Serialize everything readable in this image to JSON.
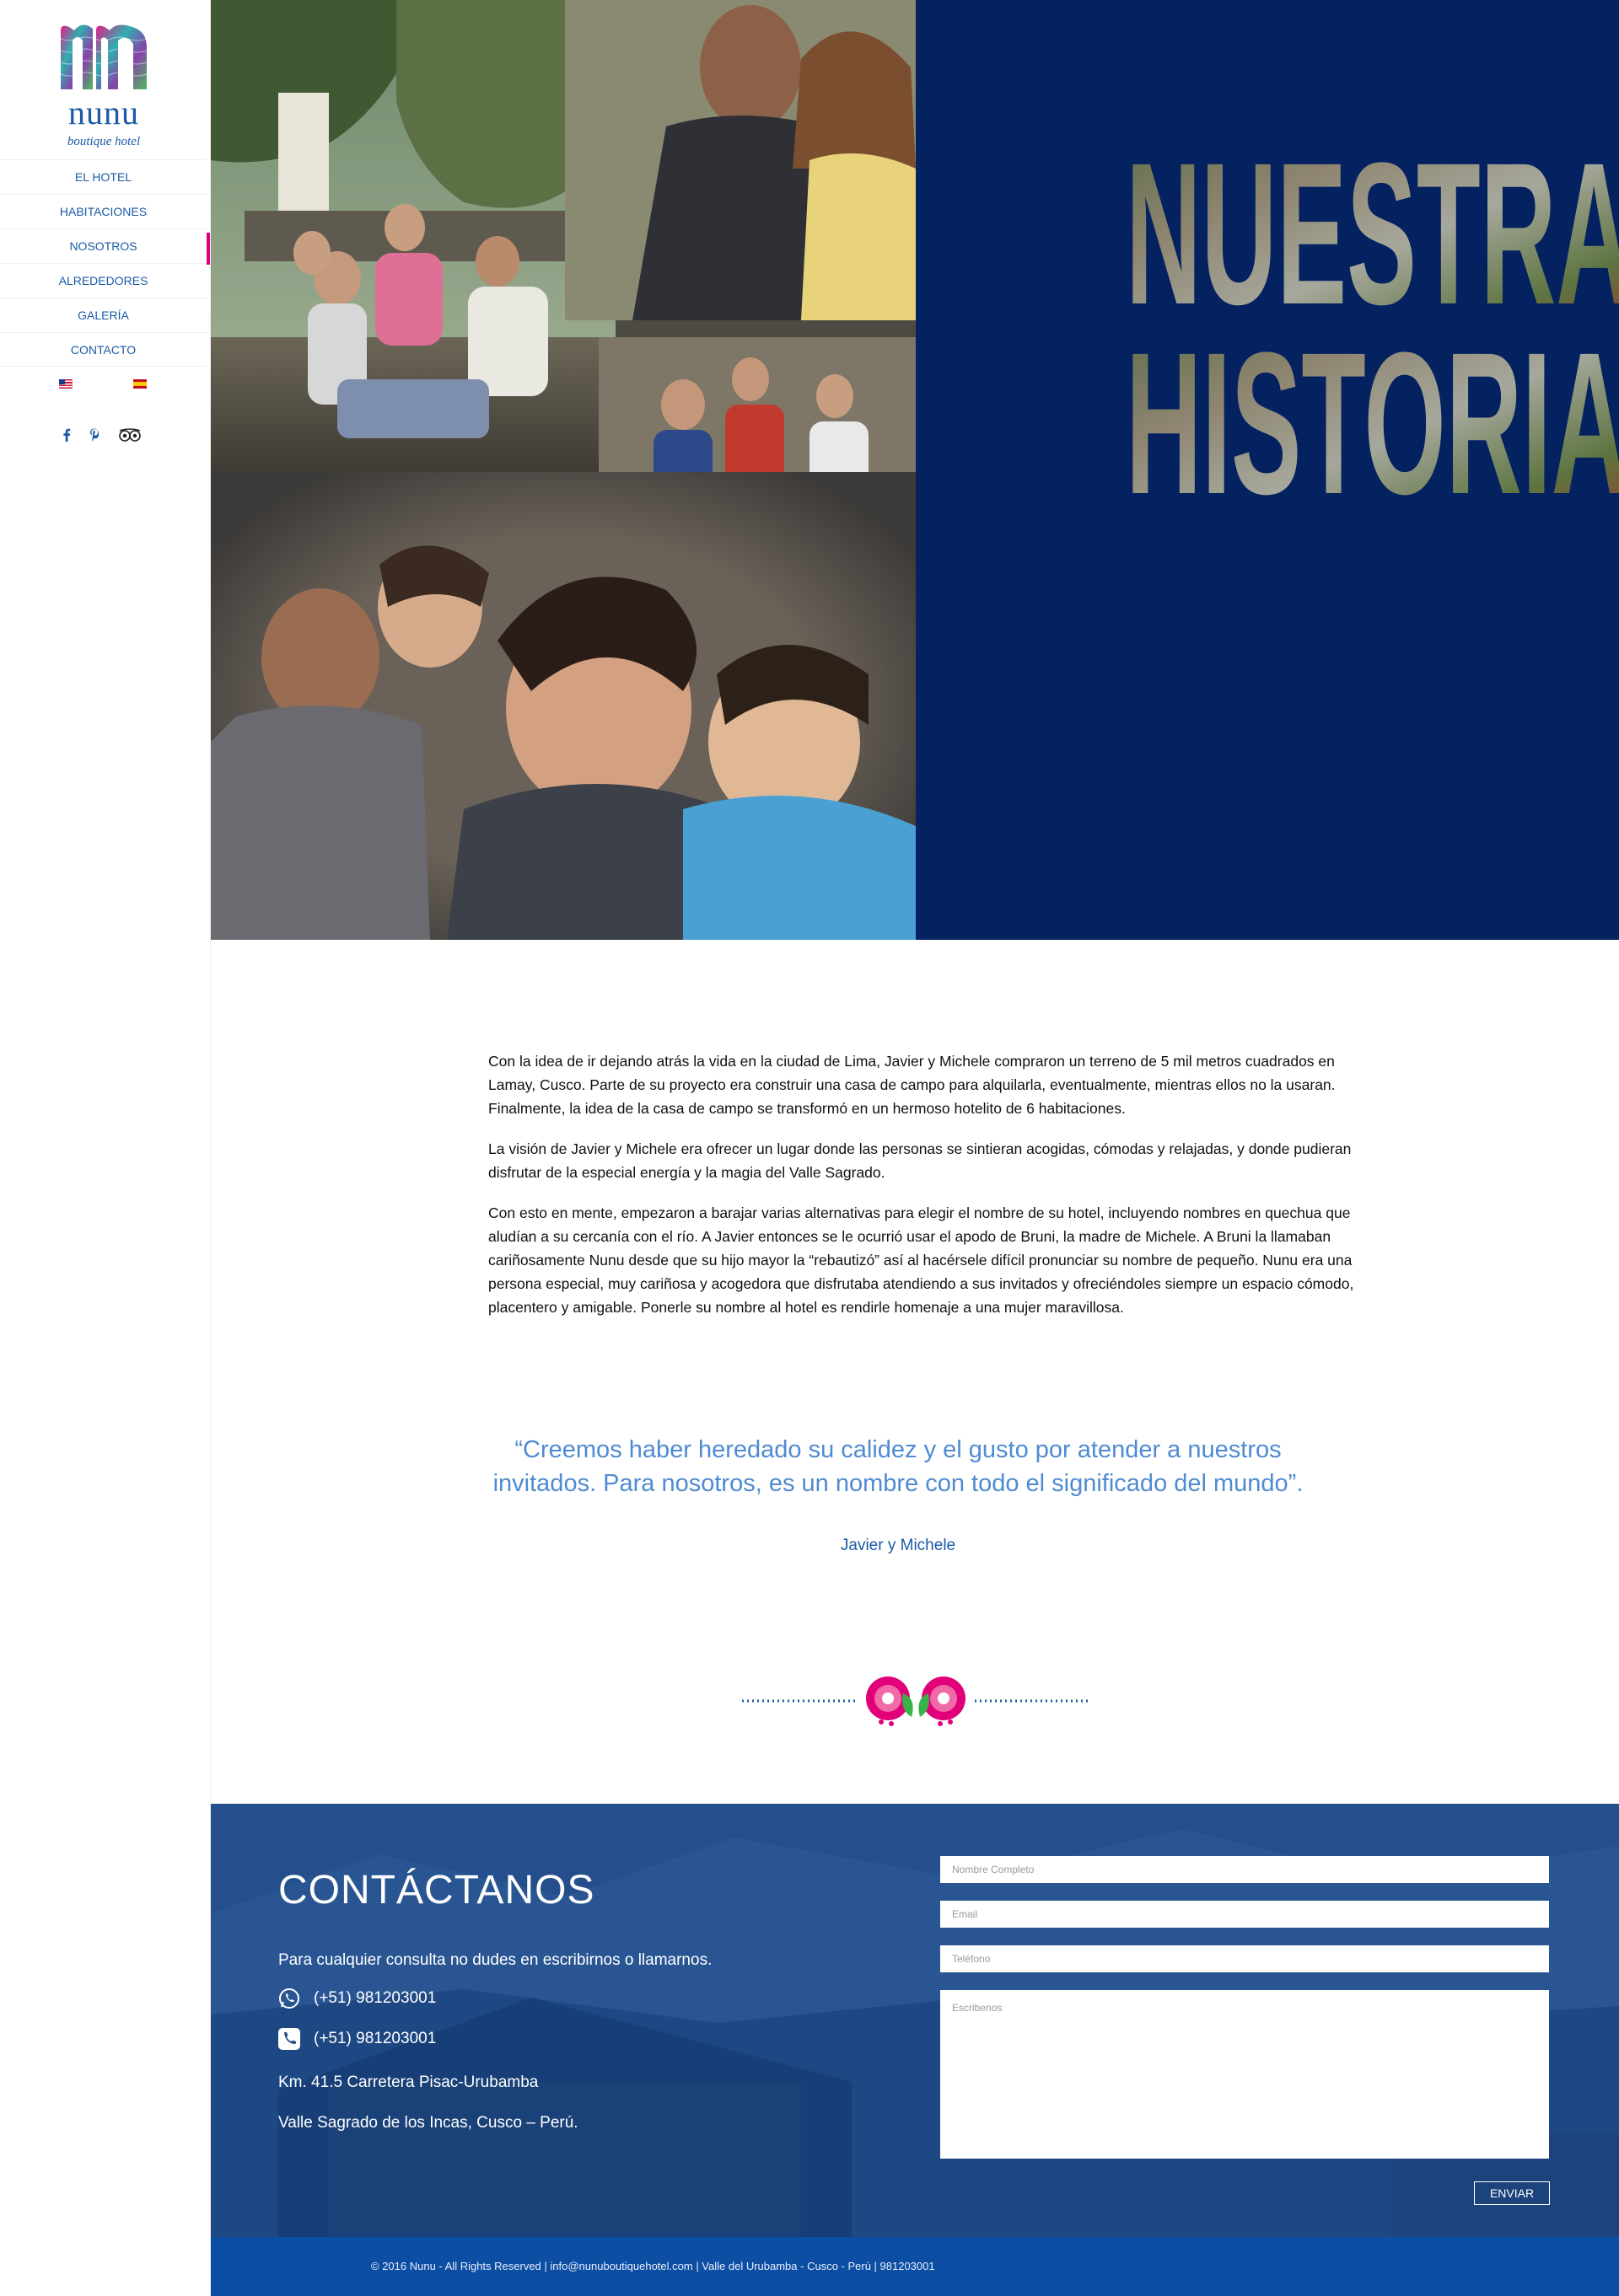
{
  "brand": {
    "logo_text": "nunu",
    "logo_subtitle": "boutique hotel"
  },
  "nav": {
    "items": [
      {
        "label": "EL HOTEL"
      },
      {
        "label": "HABITACIONES"
      },
      {
        "label": "NOSOTROS"
      },
      {
        "label": "ALREDEDORES"
      },
      {
        "label": "GALERÍA"
      },
      {
        "label": "CONTACTO"
      }
    ],
    "active": "NOSOTROS"
  },
  "languages": [
    "en",
    "es"
  ],
  "social": {
    "facebook": "f",
    "pinterest": "p",
    "tripadvisor": "tripadvisor-icon"
  },
  "hero": {
    "title_line1": "NUESTRA",
    "title_line2": "HISTORIA",
    "background": "#042160"
  },
  "story": {
    "p1": "Con la idea de ir dejando atrás la vida en la ciudad de Lima, Javier y Michele compraron un terreno de 5 mil metros cuadrados en Lamay, Cusco. Parte de su proyecto era construir una casa de campo para alquilarla, eventualmente, mientras ellos no la usaran. Finalmente, la idea de la casa de campo se transformó en un hermoso hotelito de 6 habitaciones.",
    "p2": "La visión de Javier y Michele era ofrecer un lugar donde las personas se sintieran acogidas, cómodas y relajadas, y donde pudieran disfrutar de la especial energía y la magia del Valle Sagrado.",
    "p3": "Con esto en mente, empezaron a barajar varias alternativas para elegir el nombre de su hotel, incluyendo nombres en quechua que aludían a su cercanía con el río. A Javier entonces se le ocurrió usar el apodo de Bruni, la madre de Michele. A Bruni la llamaban cariñosamente Nunu desde que su hijo mayor la “rebautizó” así al hacérsele difícil pronunciar su nombre de pequeño. Nunu era una persona especial, muy cariñosa y acogedora que disfrutaba atendiendo a sus invitados y ofreciéndoles siempre un espacio cómodo, placentero y amigable. Ponerle su nombre al hotel es rendirle homenaje a una mujer maravillosa."
  },
  "quote": {
    "text": "“Creemos haber heredado su calidez y el gusto por atender a nuestros invitados. Para nosotros, es un nombre con todo el significado del mundo”.",
    "author": "Javier y Michele"
  },
  "contact": {
    "title": "CONTÁCTANOS",
    "intro": "Para cualquier consulta no dudes en escribirnos o llamarnos.",
    "whatsapp": "(+51) 981203001",
    "phone": "(+51)  981203001",
    "address1": "Km. 41.5 Carretera Pisac-Urubamba",
    "address2": "Valle Sagrado de los Incas, Cusco – Perú.",
    "form": {
      "name_placeholder": "Nombre Completo",
      "email_placeholder": "Email",
      "phone_placeholder": "Teléfono",
      "message_placeholder": "Escribenos",
      "submit_label": "ENVIAR"
    }
  },
  "footer": {
    "text": "© 2016 Nunu - All Rights Reserved | info@nunuboutiquehotel.com | Valle del Urubamba - Cusco - Perú | 981203001"
  },
  "colors": {
    "brand_blue": "#1b5aa6",
    "accent_pink": "#e1007a",
    "hero_navy": "#042160",
    "footer_blue": "#0d4ea5"
  }
}
